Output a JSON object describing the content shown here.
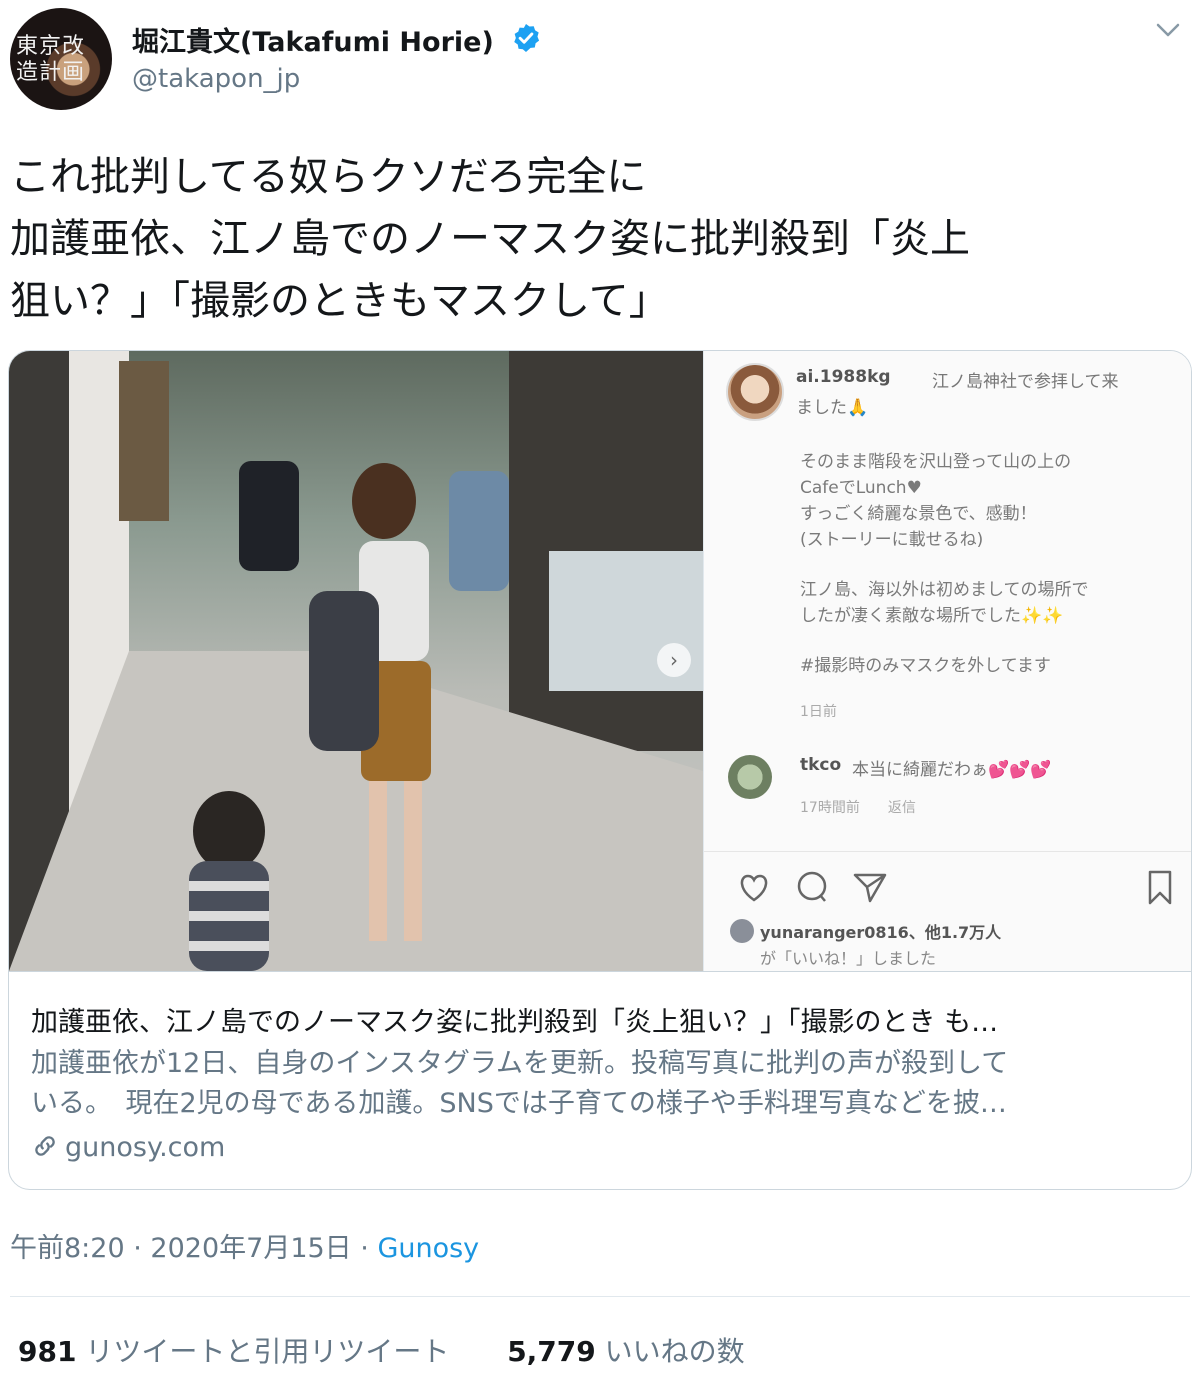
{
  "user": {
    "display_name": "堀江貴文(Takafumi Horie)",
    "handle": "@takapon_jp",
    "avatar_text": "東京改造計画",
    "verified_color": "#1da1f2"
  },
  "tweet": {
    "lines": [
      "これ批判してる奴らクソだろ完全に",
      "加護亜依、江ノ島でのノーマスク姿に批判殺到「炎上",
      "狙い？」「撮影のときもマスクして」"
    ]
  },
  "card": {
    "image": {
      "insta_user": "ai.1988kg",
      "insta_caption_a": "江ノ島神社で参拝して来",
      "insta_caption_b": "ました🙏",
      "insta_lines": [
        "そのまま階段を沢山登って山の上の",
        "CafeでLunch♥",
        "すっごく綺麗な景色で、感動！",
        "(ストーリーに載せるね)",
        "江ノ島、海以外は初めましての場所で",
        "したが凄く素敵な場所でした✨✨",
        "#撮影時のみマスクを外してます"
      ],
      "insta_time": "1日前",
      "comment_user": "tkco",
      "comment_text": "本当に綺麗だわぁ💕💕💕",
      "comment_meta": "17時間前",
      "comment_reply": "返信",
      "likes_line1": "yunaranger0816、他1.7万人",
      "likes_line2": "が「いいね！」しました"
    },
    "title": "加護亜依、江ノ島でのノーマスク姿に批判殺到「炎上狙い？」「撮影のとき も…",
    "description": [
      "加護亜依が12日、自身のインスタグラムを更新。投稿写真に批判の声が殺到して",
      "いる。　現在2児の母である加護。SNSでは子育ての様子や手料理写真などを披…"
    ],
    "domain": "gunosy.com"
  },
  "meta": {
    "time": "午前8:20",
    "date": "2020年7月15日",
    "dot": "·",
    "source": "Gunosy"
  },
  "stats": {
    "retweets": "981",
    "retweets_label": "リツイートと引用リツイート",
    "likes": "5,779",
    "likes_label": "いいねの数"
  },
  "colors": {
    "link": "#1b95e0",
    "secondary": "#657786"
  }
}
